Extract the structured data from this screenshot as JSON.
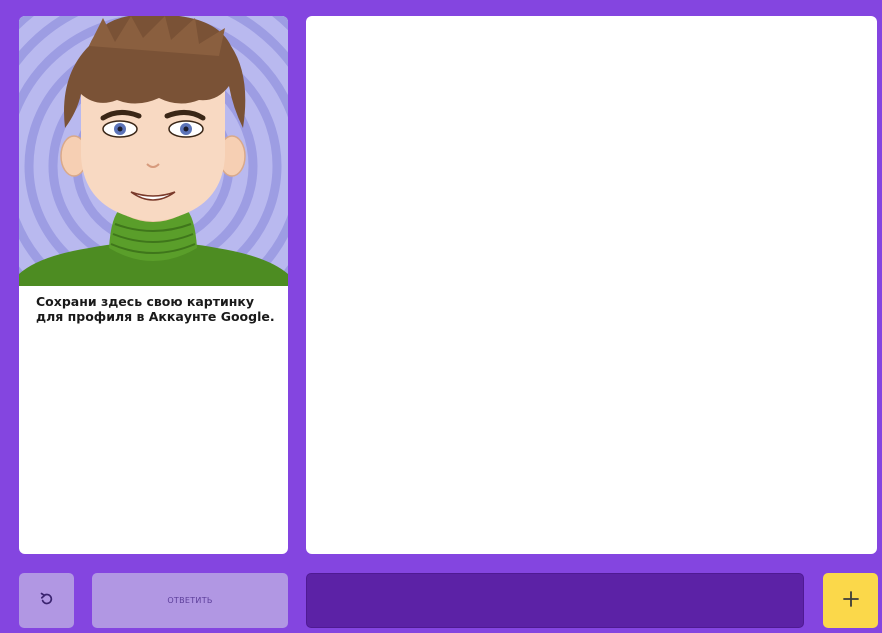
{
  "prompt": {
    "text": "Сохрани здесь свою картинку для профиля в Аккаунте Google."
  },
  "controls": {
    "answer_label": "ОТВЕТИТЬ",
    "undo_icon": "undo-icon",
    "add_icon": "plus-icon",
    "answer_input_value": ""
  },
  "colors": {
    "background": "#8445e0",
    "card": "#ffffff",
    "secondary_button": "#b197e3",
    "input": "#5c22a6",
    "add_button": "#fbd84a"
  }
}
